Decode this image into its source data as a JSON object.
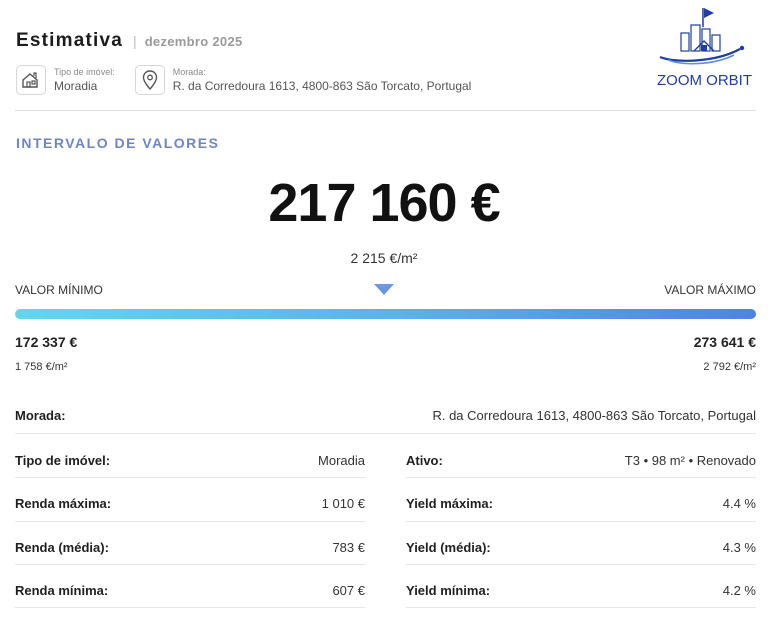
{
  "header": {
    "title": "Estimativa",
    "separator": "|",
    "date": "dezembro 2025",
    "property_type_label": "Tipo de imóvel:",
    "property_type_value": "Moradia",
    "address_label": "Morada:",
    "address_value": "R. da Corredoura 1613, 4800-863 São Torcato, Portugal"
  },
  "logo": {
    "text": "ZOOM ORBIT"
  },
  "valuation": {
    "section_title": "INTERVALO DE VALORES",
    "estimate": "217 160 €",
    "estimate_per_m2": "2 215 €/m²",
    "min_label": "VALOR MÍNIMO",
    "max_label": "VALOR MÁXIMO",
    "min_value": "172 337 €",
    "max_value": "273 641 €",
    "min_per_m2": "1 758 €/m²",
    "max_per_m2": "2 792 €/m²"
  },
  "details": {
    "address_label": "Morada:",
    "address_value": "R. da Corredoura 1613, 4800-863 São Torcato, Portugal",
    "left": [
      {
        "label": "Tipo de imóvel:",
        "value": "Moradia"
      },
      {
        "label": "Renda máxima:",
        "value": "1 010 €"
      },
      {
        "label": "Renda (média):",
        "value": "783 €"
      },
      {
        "label": "Renda mínima:",
        "value": "607 €"
      }
    ],
    "right": [
      {
        "label": "Ativo:",
        "value": "T3 • 98 m² • Renovado"
      },
      {
        "label": "Yield máxima:",
        "value": "4.4 %"
      },
      {
        "label": "Yield (média):",
        "value": "4.3 %"
      },
      {
        "label": "Yield mínima:",
        "value": "4.2 %"
      }
    ]
  },
  "colors": {
    "accent_title": "#6f86c6",
    "bar_start": "#5fd8ef",
    "bar_end": "#4f82e8",
    "marker": "#6b98e0",
    "logo_blue": "#1f3f9e"
  }
}
